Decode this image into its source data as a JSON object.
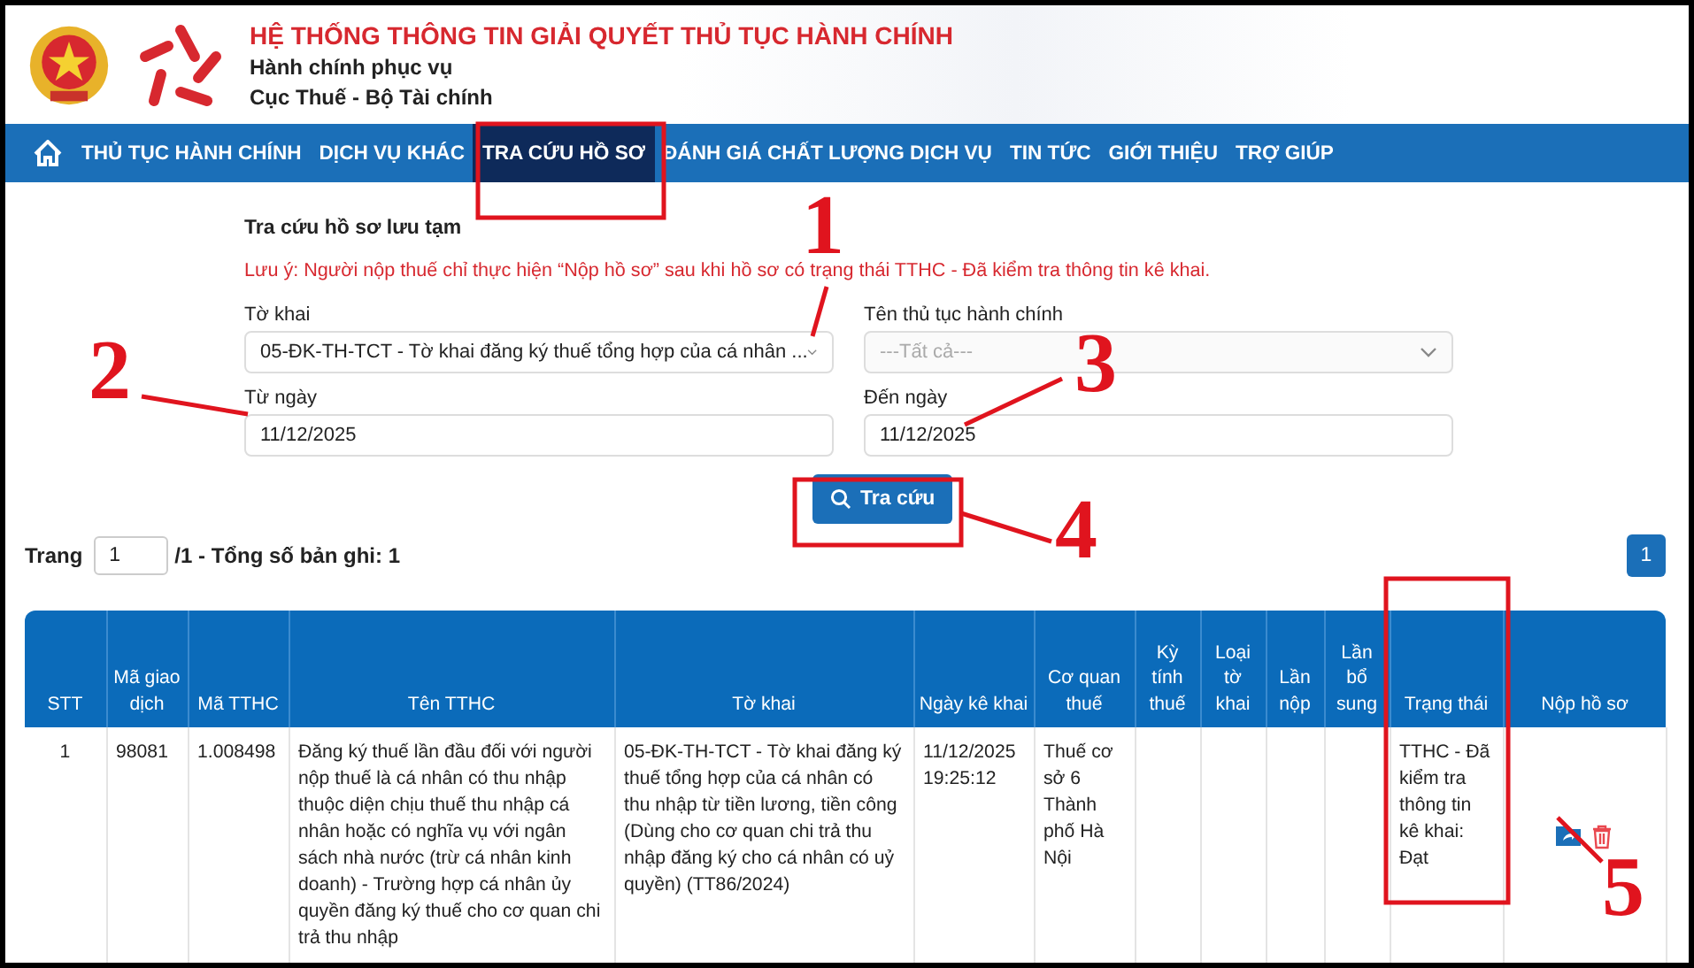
{
  "header": {
    "title": "HỆ THỐNG THÔNG TIN GIẢI QUYẾT THỦ TỤC HÀNH CHÍNH",
    "subtitle": "Hành chính phục vụ",
    "agency": "Cục Thuế - Bộ Tài chính"
  },
  "nav": [
    {
      "label": "THỦ TỤC HÀNH CHÍNH",
      "selected": false
    },
    {
      "label": "DỊCH VỤ KHÁC",
      "selected": false
    },
    {
      "label": "TRA CỨU HỒ SƠ",
      "selected": true
    },
    {
      "label": "ĐÁNH GIÁ CHẤT LƯỢNG DỊCH VỤ",
      "selected": false
    },
    {
      "label": "TIN TỨC",
      "selected": false
    },
    {
      "label": "GIỚI THIỆU",
      "selected": false
    },
    {
      "label": "TRỢ GIÚP",
      "selected": false
    }
  ],
  "search": {
    "title": "Tra cứu hồ sơ lưu tạm",
    "note": "Lưu ý: Người nộp thuế chỉ thực hiện “Nộp hồ sơ” sau khi hồ sơ có trạng thái TTHC - Đã kiểm tra thông tin kê khai.",
    "fields": [
      {
        "kind": "select",
        "label": "Tờ khai",
        "value": "05-ĐK-TH-TCT - Tờ khai đăng ký thuế tổng hợp của cá nhân ..."
      },
      {
        "kind": "select",
        "label": "Tên thủ tục hành chính",
        "placeholder": "---Tất cả---"
      },
      {
        "kind": "date",
        "label": "Từ ngày",
        "value": "11/12/2025"
      },
      {
        "kind": "date",
        "label": "Đến ngày",
        "value": "11/12/2025"
      }
    ],
    "button": "Tra cứu"
  },
  "pager": {
    "prefix": "Trang",
    "page": "1",
    "summary": "/1 - Tổng số bản ghi: 1",
    "page_button": "1"
  },
  "table": {
    "columns": [
      "STT",
      "Mã giao dịch",
      "Mã TTHC",
      "Tên TTHC",
      "Tờ khai",
      "Ngày kê khai",
      "Cơ quan thuế",
      "Kỳ tính thuế",
      "Loại tờ khai",
      "Lần nộp",
      "Lần bổ sung",
      "Trạng thái",
      "Nộp hồ sơ"
    ],
    "rows": [
      {
        "cells": [
          "1",
          "98081",
          "1.008498",
          "Đăng ký thuế lần đầu đối với người nộp thuế là cá nhân có thu nhập thuộc diện chịu thuế thu nhập cá nhân hoặc có nghĩa vụ với ngân sách nhà nước (trừ cá nhân kinh doanh) - Trường hợp cá nhân ủy quyền đăng ký thuế cho cơ quan chi trả thu nhập",
          "05-ĐK-TH-TCT - Tờ khai đăng ký thuế tổng hợp của cá nhân có thu nhập từ tiền lương, tiền công (Dùng cho cơ quan chi trả thu nhập đăng ký cho cá nhân có uỷ quyền) (TT86/2024)",
          "11/12/2025 19:25:12",
          "Thuế cơ sở 6 Thành phố Hà Nội",
          "",
          "",
          "",
          "",
          "TTHC - Đã kiểm tra thông tin kê khai: Đạt"
        ]
      }
    ]
  },
  "annotations": [
    {
      "label": "1"
    },
    {
      "label": "2"
    },
    {
      "label": "3"
    },
    {
      "label": "4"
    },
    {
      "label": "5"
    }
  ]
}
